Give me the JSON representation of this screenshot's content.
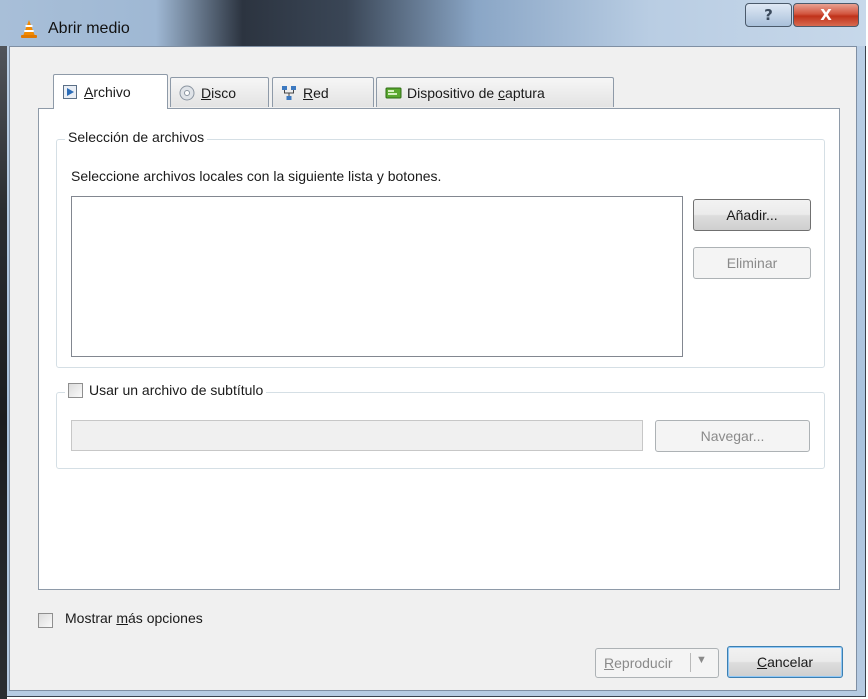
{
  "window": {
    "title": "Abrir medio",
    "help_label": "?",
    "close_label": "X"
  },
  "tabs": [
    {
      "label_u": "A",
      "label_rest": "rchivo",
      "icon": "play-file-icon"
    },
    {
      "label_u": "D",
      "label_rest": "isco",
      "icon": "disc-icon"
    },
    {
      "label_u": "R",
      "label_rest": "ed",
      "icon": "network-icon"
    },
    {
      "label_pre": "Dispositivo de ",
      "label_u": "c",
      "label_rest": "aptura",
      "icon": "capture-card-icon"
    }
  ],
  "file_group": {
    "legend": "Selección de archivos",
    "description": "Seleccione archivos locales con la siguiente lista y botones.",
    "add_button": "Añadir...",
    "remove_button": "Eliminar",
    "files": []
  },
  "subtitle_group": {
    "checkbox_label": "Usar un archivo de subtítulo",
    "checked": false,
    "path_value": "",
    "browse_button": "Navegar..."
  },
  "footer": {
    "more_options_pre": "Mostrar ",
    "more_options_u": "m",
    "more_options_rest": "ás opciones",
    "more_options_checked": false,
    "play_u": "R",
    "play_rest": "eproducir",
    "cancel_u": "C",
    "cancel_rest": "ancelar"
  },
  "colors": {
    "vlc_orange": "#f28a00",
    "close_red": "#c0321a"
  }
}
